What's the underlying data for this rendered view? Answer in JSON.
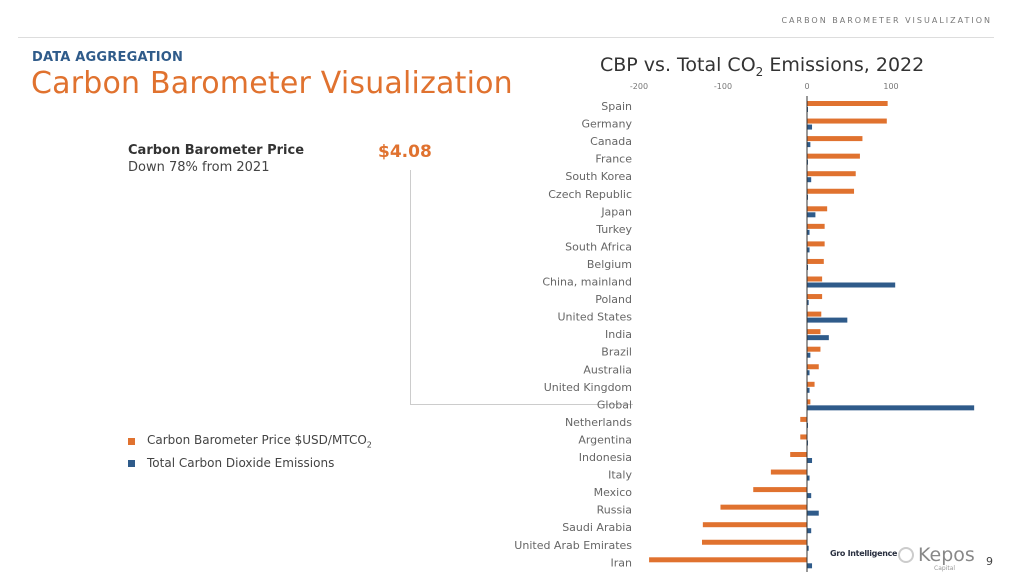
{
  "header": {
    "top_title": "CARBON BAROMETER VISUALIZATION"
  },
  "section_label": "DATA AGGREGATION",
  "page_title": "Carbon Barometer Visualization",
  "cbp": {
    "label": "Carbon Barometer Price",
    "subtitle": "Down 78% from 2021",
    "value": "$4.08"
  },
  "legend": {
    "items": [
      {
        "label": "Carbon Barometer Price $USD/MTCO",
        "sub": "2",
        "color": "#e0722f"
      },
      {
        "label": "Total Carbon Dioxide Emissions",
        "sub": "",
        "color": "#2f5b8a"
      }
    ]
  },
  "footer": {
    "gro": "Gro Intelligence",
    "kepos": "Kepos",
    "kepos_sub": "Capital",
    "page": "9"
  },
  "chart_data": {
    "type": "bar",
    "orientation": "horizontal",
    "title_pre": "CBP vs. Total CO",
    "title_sub": "2",
    "title_post": " Emissions, 2022",
    "xlim": [
      -200,
      100
    ],
    "xticks": [
      -200,
      -100,
      0,
      100
    ],
    "grid": false,
    "legend_position": "left",
    "categories": [
      "Spain",
      "Germany",
      "Canada",
      "France",
      "South Korea",
      "Czech Republic",
      "Japan",
      "Turkey",
      "South Africa",
      "Belgium",
      "China, mainland",
      "Poland",
      "United States",
      "India",
      "Brazil",
      "Australia",
      "United Kingdom",
      "Global",
      "Netherlands",
      "Argentina",
      "Indonesia",
      "Italy",
      "Mexico",
      "Russia",
      "Saudi Arabia",
      "United Arab Emirates",
      "Iran"
    ],
    "series": [
      {
        "name": "Carbon Barometer Price $USD/MTCO2",
        "color": "#e0722f",
        "values": [
          96,
          95,
          66,
          63,
          58,
          56,
          24,
          21,
          21,
          20,
          18,
          18,
          17,
          16,
          16,
          14,
          9,
          4,
          -8,
          -8,
          -20,
          -43,
          -64,
          -103,
          -124,
          -125,
          -188
        ]
      },
      {
        "name": "Total Carbon Dioxide Emissions",
        "color": "#2f5b8a",
        "values": [
          1,
          6,
          4,
          1,
          5,
          0.5,
          10,
          3,
          3,
          0.5,
          105,
          2,
          48,
          26,
          4,
          3,
          3,
          199,
          1,
          1,
          6,
          3,
          5,
          14,
          5,
          2,
          6
        ]
      }
    ]
  }
}
